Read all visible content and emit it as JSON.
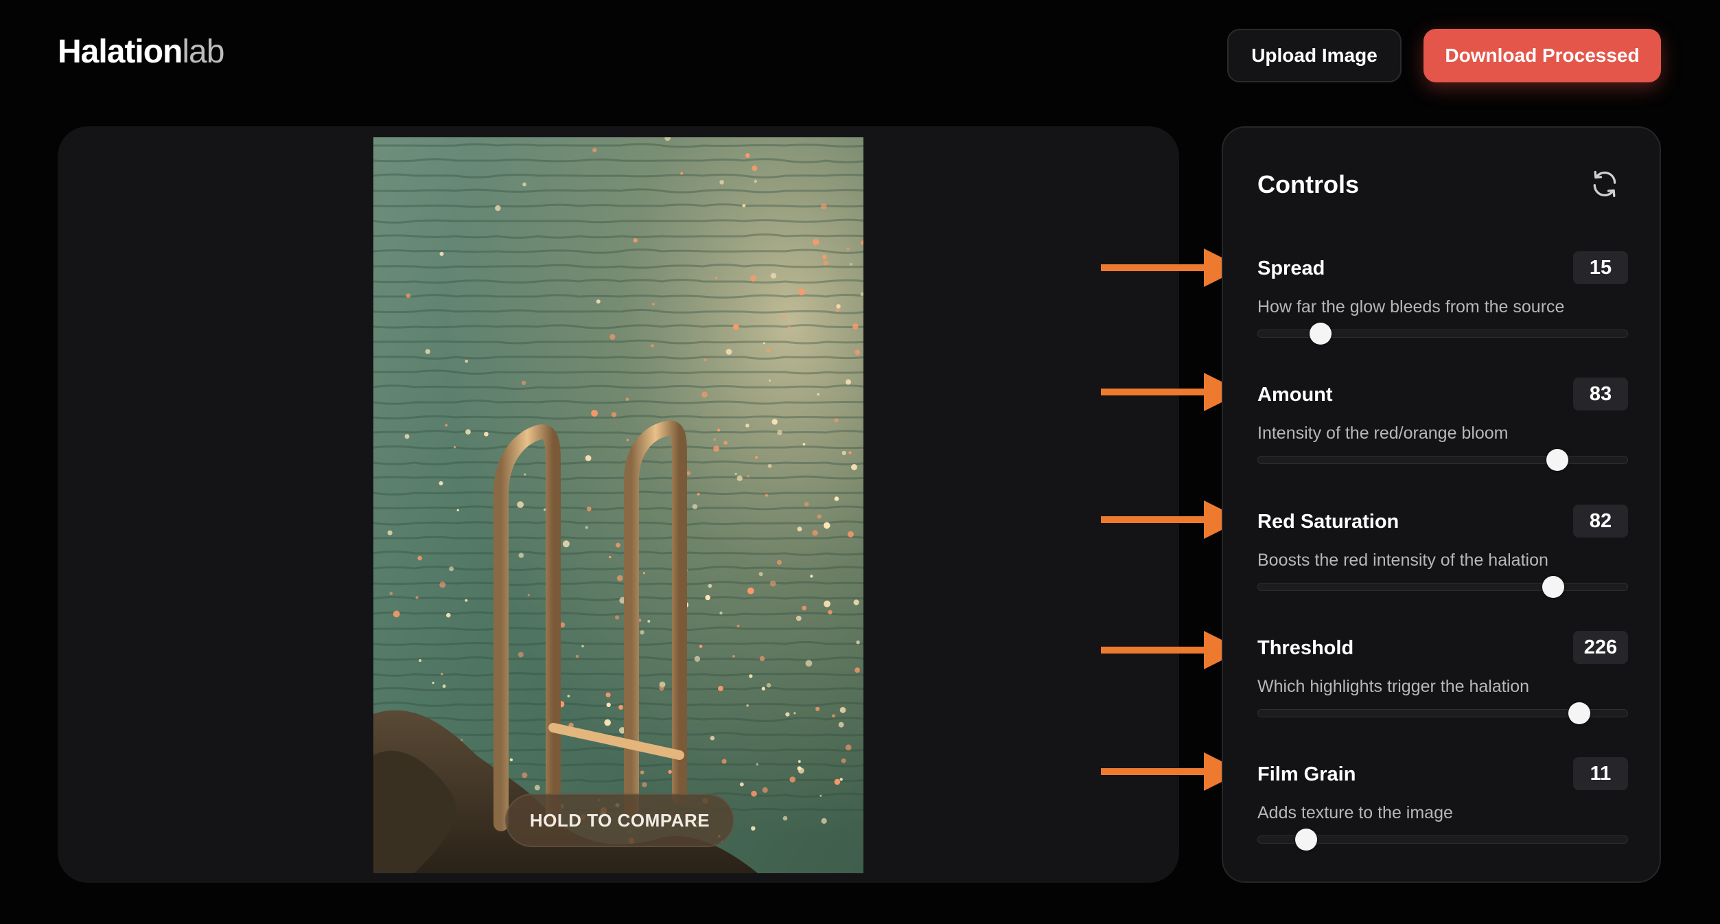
{
  "brand": {
    "name_strong": "Halation",
    "name_light": "lab"
  },
  "header": {
    "upload_label": "Upload Image",
    "download_label": "Download Processed"
  },
  "preview": {
    "compare_label": "HOLD TO COMPARE"
  },
  "controls": {
    "title": "Controls",
    "reset_icon": "refresh-icon",
    "items": [
      {
        "label": "Spread",
        "value": "15",
        "description": "How far the glow bleeds from the source",
        "fraction": 0.17
      },
      {
        "label": "Amount",
        "value": "83",
        "description": "Intensity of the red/orange bloom",
        "fraction": 0.81
      },
      {
        "label": "Red Saturation",
        "value": "82",
        "description": "Boosts the red intensity of the halation",
        "fraction": 0.8
      },
      {
        "label": "Threshold",
        "value": "226",
        "description": "Which highlights trigger the halation",
        "fraction": 0.87
      },
      {
        "label": "Film Grain",
        "value": "11",
        "description": "Adds texture to the image",
        "fraction": 0.13
      }
    ]
  },
  "colors": {
    "accent": "#e4564a",
    "annotation_arrow": "#ee7a30",
    "panel_bg": "#131315",
    "page_bg": "#030303"
  }
}
